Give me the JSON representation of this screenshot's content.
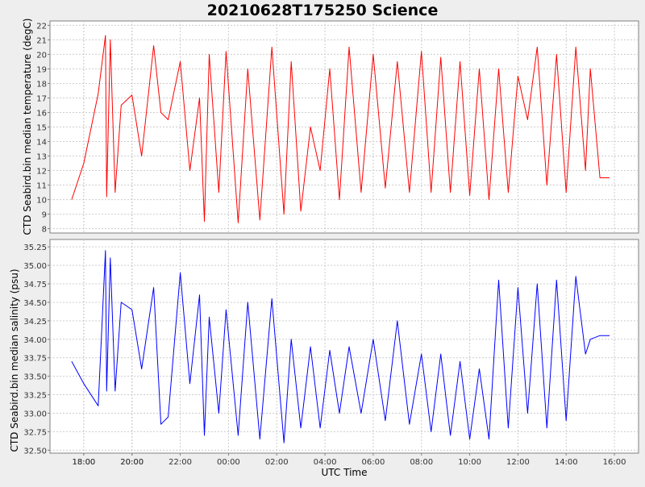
{
  "chart_data": [
    {
      "type": "line",
      "title": "20210628T175250 Science",
      "xlabel": "UTC Time",
      "ylabel": "CTD Seabird.bin median temperature (degC)",
      "x_ticks": [
        "18:00",
        "20:00",
        "22:00",
        "00:00",
        "02:00",
        "04:00",
        "06:00",
        "08:00",
        "10:00",
        "12:00",
        "14:00",
        "16:00",
        "18:00",
        "20:00"
      ],
      "y_ticks": [
        8,
        9,
        10,
        11,
        12,
        13,
        14,
        15,
        16,
        17,
        18,
        19,
        20,
        21,
        22
      ],
      "ylim": [
        7.7,
        22.3
      ],
      "xlim_hours": [
        16.6,
        41.0
      ],
      "grid": true,
      "legend": "none",
      "color": "#ff0000",
      "series": [
        {
          "x": [
            17.5,
            18.0,
            18.6,
            18.9,
            18.95,
            19.1,
            19.3,
            19.55,
            20.0,
            20.4,
            20.9,
            21.2,
            21.5,
            22.0,
            22.4,
            22.8,
            23.0,
            23.2,
            23.6,
            23.9,
            24.4,
            24.8,
            25.3,
            25.8,
            26.3,
            26.6,
            27.0,
            27.4,
            27.8,
            28.2,
            28.6,
            29.0,
            29.5,
            30.0,
            30.5,
            31.0,
            31.5,
            32.0,
            32.4,
            32.8,
            33.2,
            33.6,
            34.0,
            34.4,
            34.8,
            35.2,
            35.6,
            36.0,
            36.4,
            36.8,
            37.2,
            37.6,
            38.0,
            38.4,
            38.8,
            39.0,
            39.4,
            39.6,
            39.8
          ],
          "y": [
            10.0,
            12.5,
            17.3,
            21.3,
            10.2,
            21.0,
            10.5,
            16.5,
            17.2,
            13.0,
            20.6,
            16.0,
            15.5,
            19.5,
            12.0,
            17.0,
            8.5,
            20.0,
            10.5,
            20.2,
            8.4,
            19.0,
            8.6,
            20.5,
            9.0,
            19.5,
            9.2,
            15.0,
            12.0,
            19.0,
            10.0,
            20.5,
            10.5,
            20.0,
            10.8,
            19.5,
            10.5,
            20.2,
            10.5,
            19.8,
            10.5,
            19.5,
            10.3,
            19.0,
            10.0,
            19.0,
            10.5,
            18.5,
            15.5,
            20.5,
            11.0,
            20.0,
            10.5,
            20.5,
            12.0,
            19.0,
            11.5,
            11.5,
            11.5
          ]
        }
      ]
    },
    {
      "type": "line",
      "xlabel": "UTC Time",
      "ylabel": "CTD Seabird.bin median salinity (psu)",
      "x_ticks": [
        "18:00",
        "20:00",
        "22:00",
        "00:00",
        "02:00",
        "04:00",
        "06:00",
        "08:00",
        "10:00",
        "12:00",
        "14:00",
        "16:00",
        "18:00",
        "20:00"
      ],
      "y_ticks": [
        "32.50",
        "32.75",
        "33.00",
        "33.25",
        "33.50",
        "33.75",
        "34.00",
        "34.25",
        "34.50",
        "34.75",
        "35.00",
        "35.25"
      ],
      "ylim": [
        32.46,
        35.35
      ],
      "xlim_hours": [
        16.6,
        41.0
      ],
      "grid": true,
      "legend": "none",
      "color": "#0000ff",
      "series": [
        {
          "x": [
            17.5,
            18.0,
            18.6,
            18.9,
            18.95,
            19.1,
            19.3,
            19.55,
            20.0,
            20.4,
            20.9,
            21.2,
            21.5,
            22.0,
            22.4,
            22.8,
            23.0,
            23.2,
            23.6,
            23.9,
            24.4,
            24.8,
            25.3,
            25.8,
            26.3,
            26.6,
            27.0,
            27.4,
            27.8,
            28.2,
            28.6,
            29.0,
            29.5,
            30.0,
            30.5,
            31.0,
            31.5,
            32.0,
            32.4,
            32.8,
            33.2,
            33.6,
            34.0,
            34.4,
            34.8,
            35.2,
            35.6,
            36.0,
            36.4,
            36.8,
            37.2,
            37.6,
            38.0,
            38.4,
            38.8,
            39.0,
            39.4,
            39.6,
            39.8
          ],
          "y": [
            33.7,
            33.4,
            33.1,
            35.2,
            33.3,
            35.1,
            33.3,
            34.5,
            34.4,
            33.6,
            34.7,
            32.85,
            32.95,
            34.9,
            33.4,
            34.6,
            32.7,
            34.3,
            33.0,
            34.4,
            32.7,
            34.5,
            32.65,
            34.55,
            32.6,
            34.0,
            32.8,
            33.9,
            32.8,
            33.85,
            33.0,
            33.9,
            33.0,
            34.0,
            32.9,
            34.25,
            32.85,
            33.8,
            32.75,
            33.8,
            32.7,
            33.7,
            32.65,
            33.6,
            32.65,
            34.8,
            32.8,
            34.7,
            33.0,
            34.75,
            32.8,
            34.8,
            32.9,
            34.85,
            33.8,
            34.0,
            34.05,
            34.05,
            34.05
          ]
        }
      ]
    }
  ]
}
